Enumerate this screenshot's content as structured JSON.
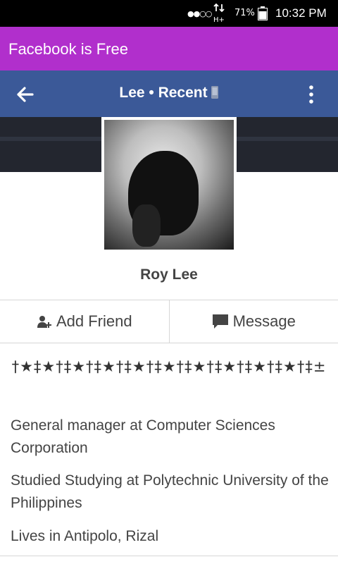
{
  "status_bar": {
    "signal_icon": "signal-dots-icon",
    "network_label": "H+",
    "battery_percent": "71%",
    "battery_icon": "battery-icon",
    "time": "10:32 PM"
  },
  "app_header": {
    "title": "Facebook is Free"
  },
  "toolbar": {
    "back_icon": "arrow-left-icon",
    "title": "Lee • Recent",
    "phone_icon": "mobile-phone-icon",
    "overflow_icon": "more-vertical-icon",
    "background": "#3b5998"
  },
  "profile": {
    "name": "Roy Lee"
  },
  "actions": {
    "add_friend_label": "Add Friend",
    "add_friend_icon": "add-person-icon",
    "message_label": "Message",
    "message_icon": "chat-bubble-icon"
  },
  "info": {
    "bio": "†★‡★†‡★†‡★†‡★†‡★†‡★†‡★†‡★†‡★†‡±",
    "work": "General manager at Computer Sciences Corporation",
    "education": "Studied Studying at Polytechnic University of the Philippines",
    "location": "Lives in Antipolo, Rizal"
  },
  "colors": {
    "app_header": "#b12fcc",
    "toolbar": "#3b5998",
    "cover": "#23262f"
  }
}
